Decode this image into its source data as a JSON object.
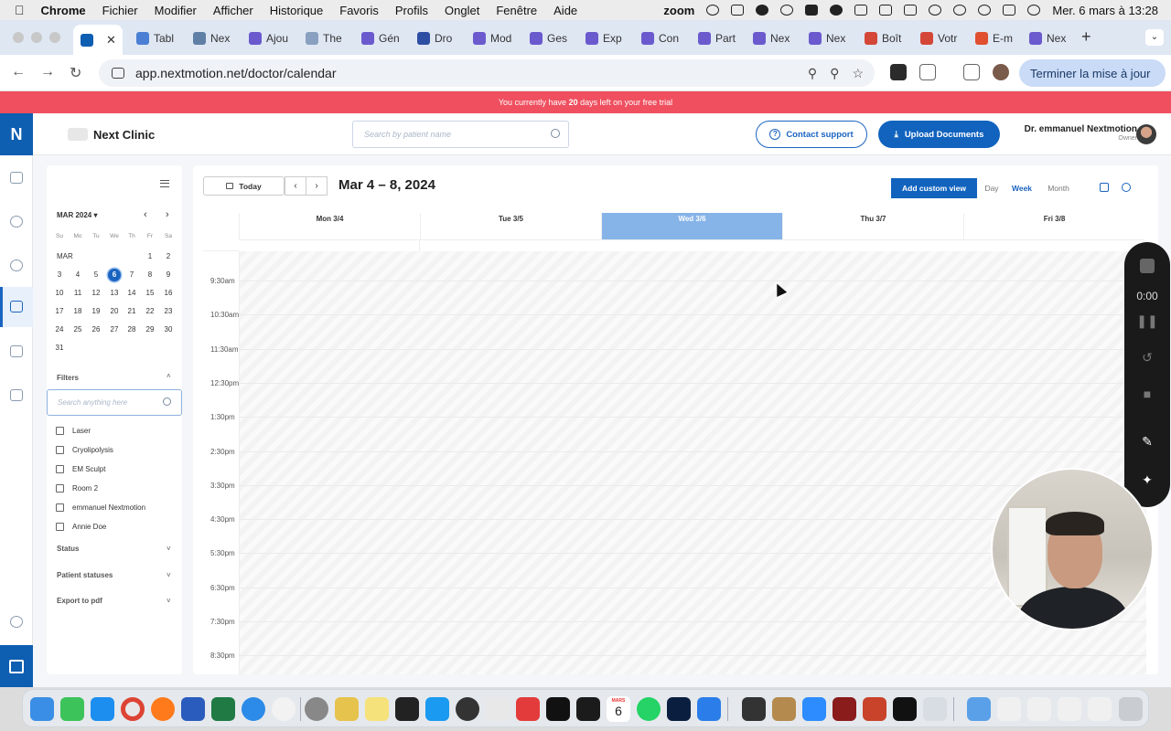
{
  "menubar": {
    "app": "Chrome",
    "items": [
      "Fichier",
      "Modifier",
      "Afficher",
      "Historique",
      "Favoris",
      "Profils",
      "Onglet",
      "Fenêtre",
      "Aide"
    ],
    "zoom": "zoom",
    "date": "Mer. 6 mars à 13:28"
  },
  "tabs": [
    {
      "label": "",
      "color": "#0e5eb1"
    },
    {
      "label": "Tabl",
      "color": "#4a7fd4"
    },
    {
      "label": "Nex",
      "color": "#5f7fa5"
    },
    {
      "label": "Ajou",
      "color": "#6a5acd"
    },
    {
      "label": "The",
      "color": "#8aa0c0"
    },
    {
      "label": "Gén",
      "color": "#6a5acd"
    },
    {
      "label": "Dro",
      "color": "#2d4ea3"
    },
    {
      "label": "Mod",
      "color": "#6a5acd"
    },
    {
      "label": "Ges",
      "color": "#6a5acd"
    },
    {
      "label": "Exp",
      "color": "#6a5acd"
    },
    {
      "label": "Con",
      "color": "#6a5acd"
    },
    {
      "label": "Part",
      "color": "#6a5acd"
    },
    {
      "label": "Nex",
      "color": "#6a5acd"
    },
    {
      "label": "Nex",
      "color": "#6a5acd"
    },
    {
      "label": "Boît",
      "color": "#d44638"
    },
    {
      "label": "Votr",
      "color": "#d44638"
    },
    {
      "label": "E-m",
      "color": "#e05030"
    },
    {
      "label": "Nex",
      "color": "#6a5acd"
    }
  ],
  "address": {
    "url": "app.nextmotion.net/doctor/calendar",
    "finish_setup": "Terminer la mise à jour"
  },
  "trial": {
    "prefix": "You currently have",
    "days": "20",
    "suffix": "days left on your free trial"
  },
  "header": {
    "clinic_name": "Next Clinic",
    "search_placeholder": "Search by patient name",
    "contact_support": "Contact support",
    "upload_documents": "Upload Documents",
    "user_name": "Dr. emmanuel Nextmotion",
    "user_role": "Owner"
  },
  "mini_calendar": {
    "month_label": "MAR 2024",
    "row_label": "MAR",
    "weekdays": [
      "Su",
      "Mo",
      "Tu",
      "We",
      "Th",
      "Fr",
      "Sa"
    ],
    "weeks": [
      [
        "",
        "",
        "",
        "",
        "",
        "1",
        "2"
      ],
      [
        "3",
        "4",
        "5",
        "6",
        "7",
        "8",
        "9"
      ],
      [
        "10",
        "11",
        "12",
        "13",
        "14",
        "15",
        "16"
      ],
      [
        "17",
        "18",
        "19",
        "20",
        "21",
        "22",
        "23"
      ],
      [
        "24",
        "25",
        "26",
        "27",
        "28",
        "29",
        "30"
      ],
      [
        "31",
        "",
        "",
        "",
        "",
        "",
        ""
      ]
    ],
    "selected": "6"
  },
  "filters": {
    "title": "Filters",
    "search_placeholder": "Search anything here",
    "items": [
      "Laser",
      "Cryolipolysis",
      "EM Sculpt",
      "Room 2",
      "emmanuel Nextmotion",
      "Annie Doe"
    ],
    "sections": [
      "Status",
      "Patient statuses",
      "Export to pdf"
    ]
  },
  "calendar": {
    "today_label": "Today",
    "range": "Mar 4 – 8, 2024",
    "custom_view": "Add custom view",
    "views": [
      "Day",
      "Week",
      "Month"
    ],
    "active_view": "Week",
    "days": [
      "Mon 3/4",
      "Tue 3/5",
      "Wed 3/6",
      "Thu 3/7",
      "Fri 3/8"
    ],
    "today_index": 2,
    "times": [
      "9:30am",
      "10:30am",
      "11:30am",
      "12:30pm",
      "1:30pm",
      "2:30pm",
      "3:30pm",
      "4:30pm",
      "5:30pm",
      "6:30pm",
      "7:30pm",
      "8:30pm"
    ]
  },
  "recorder": {
    "time": "0:00"
  }
}
